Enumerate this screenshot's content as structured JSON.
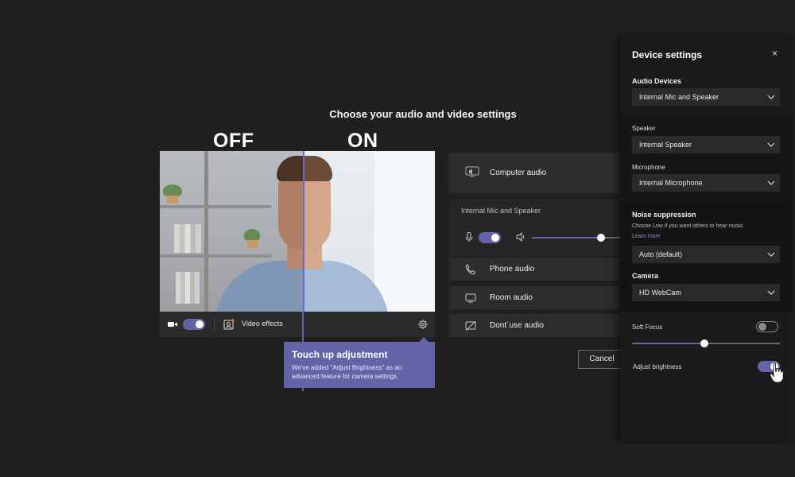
{
  "main": {
    "title": "Choose your audio and video settings",
    "compare_off": "OFF",
    "compare_on": "ON"
  },
  "video_bar": {
    "camera_on": true,
    "effects_label": "Video effects"
  },
  "tooltip": {
    "title": "Touch up adjustment",
    "body": "We've added \"Adjust Brightness\" as an advanced feature for camera settings."
  },
  "audio_options": {
    "computer_audio": "Computer audio",
    "device_name": "Internal Mic and Speaker",
    "mic_on": true,
    "volume_level": 0.78,
    "phone_audio": "Phone audio",
    "room_audio": "Room audio",
    "dont_use_audio": "Dont´use audio"
  },
  "actions": {
    "cancel": "Cancel"
  },
  "device_settings": {
    "title": "Device settings",
    "close": "×",
    "audio_devices_label": "Audio Devices",
    "audio_devices_value": "Internal Mic and Speaker",
    "speaker_label": "Speaker",
    "speaker_value": "Internal Speaker",
    "microphone_label": "Microphone",
    "microphone_value": "Internal Microphone",
    "noise_label": "Noise suppression",
    "noise_help": "Choose Low if you want others to hear music.",
    "noise_link": "Learn more",
    "noise_value": "Auto (default)",
    "camera_label": "Camera",
    "camera_value": "HD WebCam",
    "soft_focus_label": "Soft Focus",
    "soft_focus_on": false,
    "soft_focus_level": 0.49,
    "brightness_label": "Adjust brightness",
    "brightness_on": true
  },
  "colors": {
    "accent": "#6264a7",
    "background": "#1f1f1f",
    "panel": "#141414"
  }
}
